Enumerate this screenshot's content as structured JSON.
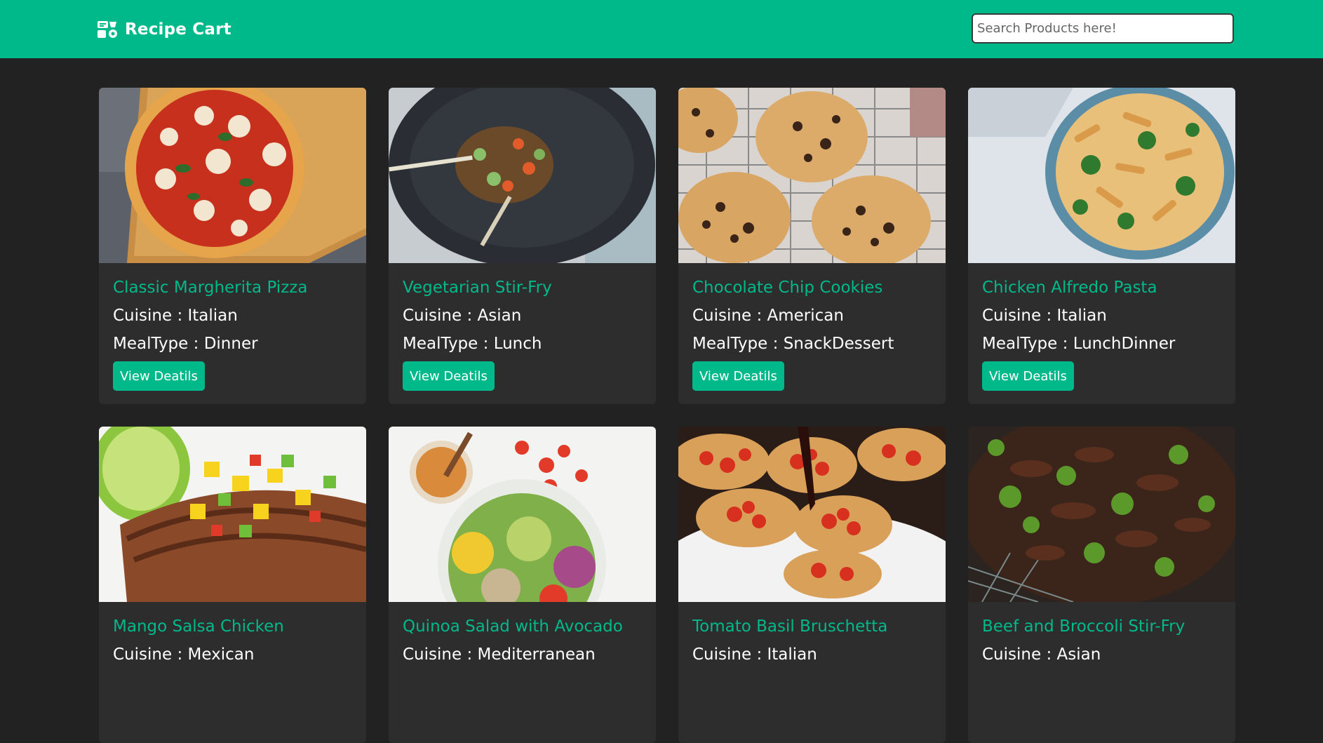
{
  "navbar": {
    "brand": "Recipe Cart",
    "brand_icon": "recipe-cart-icon",
    "search_placeholder": "Search Products here!",
    "search_value": ""
  },
  "colors": {
    "accent": "#00b98b",
    "background": "#222222",
    "card": "#2d2d2d",
    "text": "#ffffff"
  },
  "cards": [
    {
      "title": "Classic Margherita Pizza",
      "cuisine_label": "Cuisine : ",
      "cuisine": "Italian",
      "mealtype_label": "MealType : ",
      "mealtype": "Dinner",
      "button": "View Deatils",
      "image": "pizza-image"
    },
    {
      "title": "Vegetarian Stir-Fry",
      "cuisine_label": "Cuisine : ",
      "cuisine": "Asian",
      "mealtype_label": "MealType : ",
      "mealtype": "Lunch",
      "button": "View Deatils",
      "image": "stir-fry-image"
    },
    {
      "title": "Chocolate Chip Cookies",
      "cuisine_label": "Cuisine : ",
      "cuisine": "American",
      "mealtype_label": "MealType : ",
      "mealtype": "SnackDessert",
      "button": "View Deatils",
      "image": "cookies-image"
    },
    {
      "title": "Chicken Alfredo Pasta",
      "cuisine_label": "Cuisine : ",
      "cuisine": "Italian",
      "mealtype_label": "MealType : ",
      "mealtype": "LunchDinner",
      "button": "View Deatils",
      "image": "pasta-image"
    },
    {
      "title": "Mango Salsa Chicken",
      "cuisine_label": "Cuisine : ",
      "cuisine": "Mexican",
      "image": "mango-chicken-image"
    },
    {
      "title": "Quinoa Salad with Avocado",
      "cuisine_label": "Cuisine : ",
      "cuisine": "Mediterranean",
      "image": "quinoa-salad-image"
    },
    {
      "title": "Tomato Basil Bruschetta",
      "cuisine_label": "Cuisine : ",
      "cuisine": "Italian",
      "image": "bruschetta-image"
    },
    {
      "title": "Beef and Broccoli Stir-Fry",
      "cuisine_label": "Cuisine : ",
      "cuisine": "Asian",
      "image": "beef-broccoli-image"
    }
  ]
}
